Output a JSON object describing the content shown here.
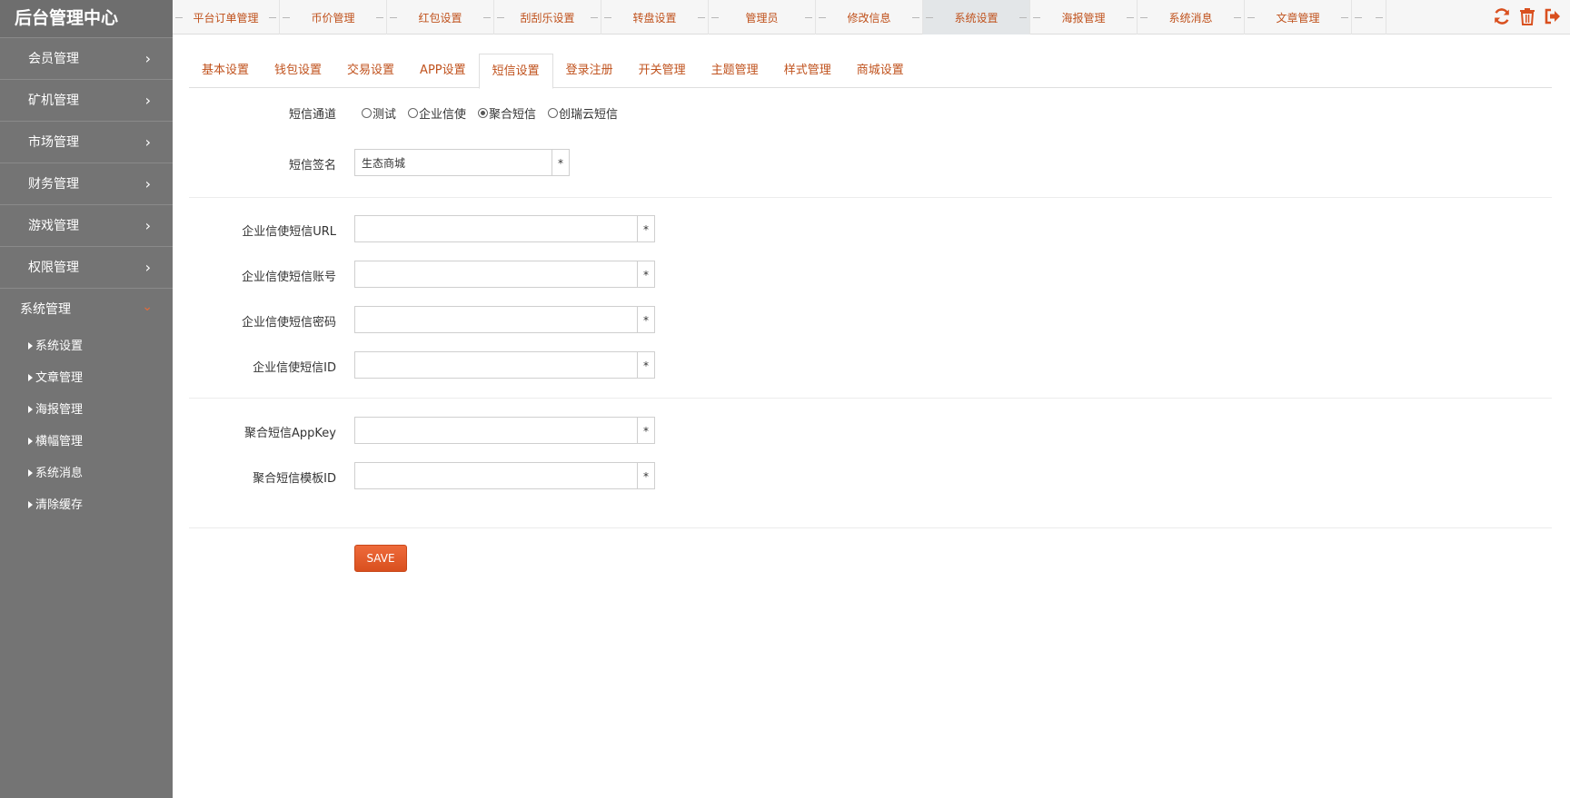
{
  "sidebar": {
    "brand": "后台管理中心",
    "items": [
      {
        "label": "会员管理",
        "chevron": "›"
      },
      {
        "label": "矿机管理",
        "chevron": "›"
      },
      {
        "label": "市场管理",
        "chevron": "›"
      },
      {
        "label": "财务管理",
        "chevron": "›"
      },
      {
        "label": "游戏管理",
        "chevron": "›"
      },
      {
        "label": "权限管理",
        "chevron": "›"
      }
    ],
    "open_item": {
      "label": "系统管理",
      "chevron": "⌄"
    },
    "sub_items": [
      {
        "label": "系统设置"
      },
      {
        "label": "文章管理"
      },
      {
        "label": "海报管理"
      },
      {
        "label": "横幅管理"
      },
      {
        "label": "系统消息"
      },
      {
        "label": "清除缓存"
      }
    ]
  },
  "topbar": {
    "tabs": [
      {
        "label": "平台订单管理"
      },
      {
        "label": "币价管理"
      },
      {
        "label": "红包设置"
      },
      {
        "label": "刮刮乐设置"
      },
      {
        "label": "转盘设置"
      },
      {
        "label": "管理员"
      },
      {
        "label": "修改信息"
      },
      {
        "label": "系统设置"
      },
      {
        "label": "海报管理"
      },
      {
        "label": "系统消息"
      },
      {
        "label": "文章管理"
      }
    ],
    "active_tab": "系统设置",
    "icons": [
      "refresh-icon",
      "trash-icon",
      "logout-icon"
    ],
    "icon_color": "#d9501f"
  },
  "subtabs": {
    "items": [
      {
        "label": "基本设置"
      },
      {
        "label": "钱包设置"
      },
      {
        "label": "交易设置"
      },
      {
        "label": "APP设置"
      },
      {
        "label": "短信设置"
      },
      {
        "label": "登录注册"
      },
      {
        "label": "开关管理"
      },
      {
        "label": "主题管理"
      },
      {
        "label": "样式管理"
      },
      {
        "label": "商城设置"
      }
    ],
    "active": "短信设置"
  },
  "form": {
    "channel": {
      "label": "短信通道",
      "options": [
        {
          "label": "测试",
          "checked": false
        },
        {
          "label": "企业信使",
          "checked": false
        },
        {
          "label": "聚合短信",
          "checked": true
        },
        {
          "label": "创瑞云短信",
          "checked": false
        }
      ]
    },
    "signature": {
      "label": "短信签名",
      "value": "生态商城",
      "req": "*"
    },
    "qyxs_url": {
      "label": "企业信使短信URL",
      "value": "",
      "req": "*"
    },
    "qyxs_account": {
      "label": "企业信使短信账号",
      "value": "",
      "req": "*"
    },
    "qyxs_password": {
      "label": "企业信使短信密码",
      "value": "",
      "req": "*"
    },
    "qyxs_id": {
      "label": "企业信使短信ID",
      "value": "",
      "req": "*"
    },
    "juhe_appkey": {
      "label": "聚合短信AppKey",
      "value": "",
      "req": "*"
    },
    "juhe_tpl": {
      "label": "聚合短信模板ID",
      "value": "",
      "req": "*"
    },
    "save_label": "SAVE"
  },
  "colors": {
    "sidebar_bg": "#747474",
    "accent": "#c0521d",
    "button": "#e35e2c"
  }
}
